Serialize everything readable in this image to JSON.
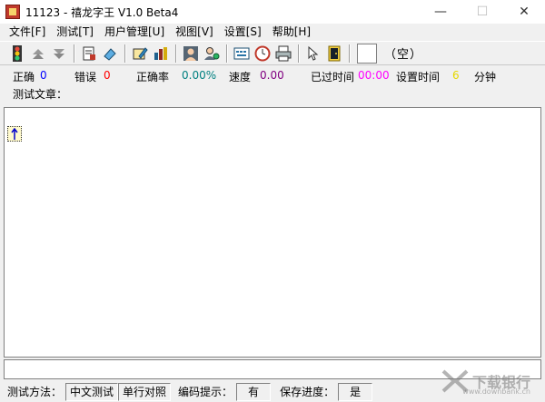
{
  "window": {
    "title": "11123 - 禧龙字王 V1.0 Beta4"
  },
  "menu": [
    "文件[F]",
    "测试[T]",
    "用户管理[U]",
    "视图[V]",
    "设置[S]",
    "帮助[H]"
  ],
  "toolbar": {
    "empty_label": "（空）"
  },
  "stats": {
    "correct_label": "正确",
    "correct_value": "0",
    "error_label": "错误",
    "error_value": "0",
    "accuracy_label": "正确率",
    "accuracy_value": "0.00%",
    "speed_label": "速度",
    "speed_value": "0.00",
    "elapsed_label": "已过时间",
    "elapsed_value": "00:00",
    "settime_label": "设置时间",
    "settime_value": "6",
    "minutes_label": "分钟"
  },
  "article_label": "测试文章：",
  "statusbar": {
    "method_label": "测试方法：",
    "method_value": "中文测试",
    "compare_value": "单行对照",
    "hint_label": "编码提示：",
    "hint_value": "有",
    "save_label": "保存进度：",
    "save_value": "是"
  },
  "watermark": {
    "main": "下载银行",
    "sub": "www.downbank.cn"
  },
  "colors": {
    "blue": "#0000ff",
    "red": "#ff0000",
    "teal": "#008080",
    "purple": "#800080",
    "magenta": "#ff00ff",
    "yellow": "#e6d800"
  }
}
